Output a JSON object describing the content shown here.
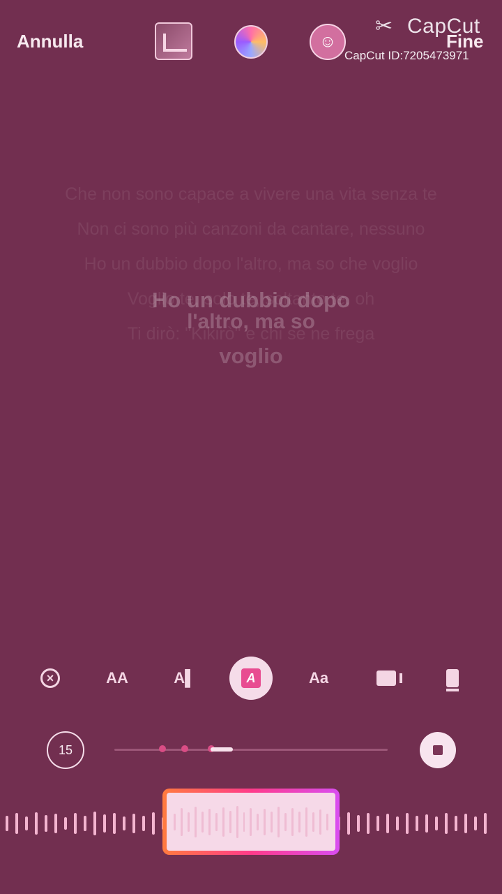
{
  "top_bar": {
    "cancel_label": "Annulla",
    "done_label": "Fine",
    "watermark_logo": "CapCut",
    "watermark_id": "CapCut ID:7205473971",
    "icons": [
      "image-thumbnail-icon",
      "color-palette-icon",
      "sticker-face-icon"
    ]
  },
  "lyrics": {
    "line1": "Che non sono capace a vivere una vita senza te",
    "line2": "Non ci sono più canzoni da cantare, nessuno",
    "line3": "Ho un dubbio dopo l'altro, ma so che voglio",
    "line4": "Voglio te, solo te, soltanto te, oh",
    "line5": "Ti dirò: \"Kikirò\" e chi se ne frega",
    "main_top": "Ho un dubbio dopo",
    "main_middle": "l'altro, ma so",
    "main_bottom": "voglio"
  },
  "toolbar": {
    "tools": [
      {
        "label": "⊗",
        "name": "close"
      },
      {
        "label": "AA",
        "name": "font-size"
      },
      {
        "label": "A▌",
        "name": "text-style"
      },
      {
        "label": "A",
        "name": "text-highlight"
      },
      {
        "label": "Aa",
        "name": "font"
      },
      {
        "label": "▮▮",
        "name": "background"
      },
      {
        "label": "▯",
        "name": "position"
      }
    ]
  },
  "timer": {
    "value": "15"
  },
  "progress": {
    "position": 0.35
  }
}
